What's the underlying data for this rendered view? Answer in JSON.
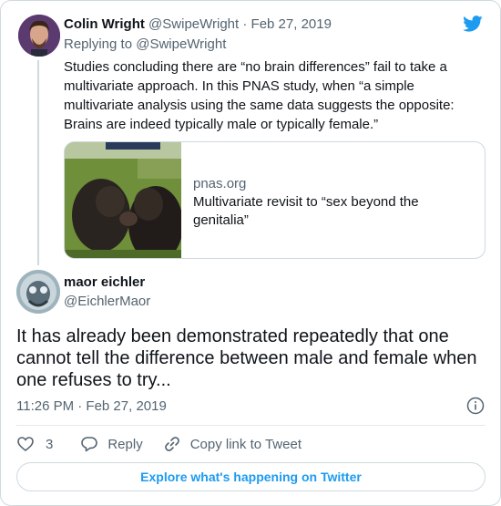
{
  "colors": {
    "brand": "#1d9bf0",
    "text": "#0f1419",
    "muted": "#536471",
    "border": "#cfd9de"
  },
  "parent_tweet": {
    "name": "Colin Wright",
    "handle": "@SwipeWright",
    "separator": "·",
    "date": "Feb 27, 2019",
    "replying_to": "Replying to @SwipeWright",
    "text": "Studies concluding there are “no brain differences” fail to take a multivariate approach. In this PNAS study, when “a simple multivariate analysis using the same data suggests the opposite: Brains are indeed typically male or typically female.”",
    "link_card": {
      "domain": "pnas.org",
      "title": "Multivariate revisit to “sex beyond the genitalia”"
    }
  },
  "main_tweet": {
    "name": "maor eichler",
    "handle": "@EichlerMaor",
    "text": "It has already been demonstrated repeatedly that one cannot tell the difference between male and female when one refuses to try...",
    "timestamp": "11:26 PM · Feb 27, 2019"
  },
  "actions": {
    "like_count": "3",
    "reply_label": "Reply",
    "copy_label": "Copy link to Tweet"
  },
  "explore_label": "Explore what's happening on Twitter",
  "icons": [
    "twitter-bird-icon",
    "info-icon",
    "heart-icon",
    "reply-bubble-icon",
    "link-icon"
  ]
}
